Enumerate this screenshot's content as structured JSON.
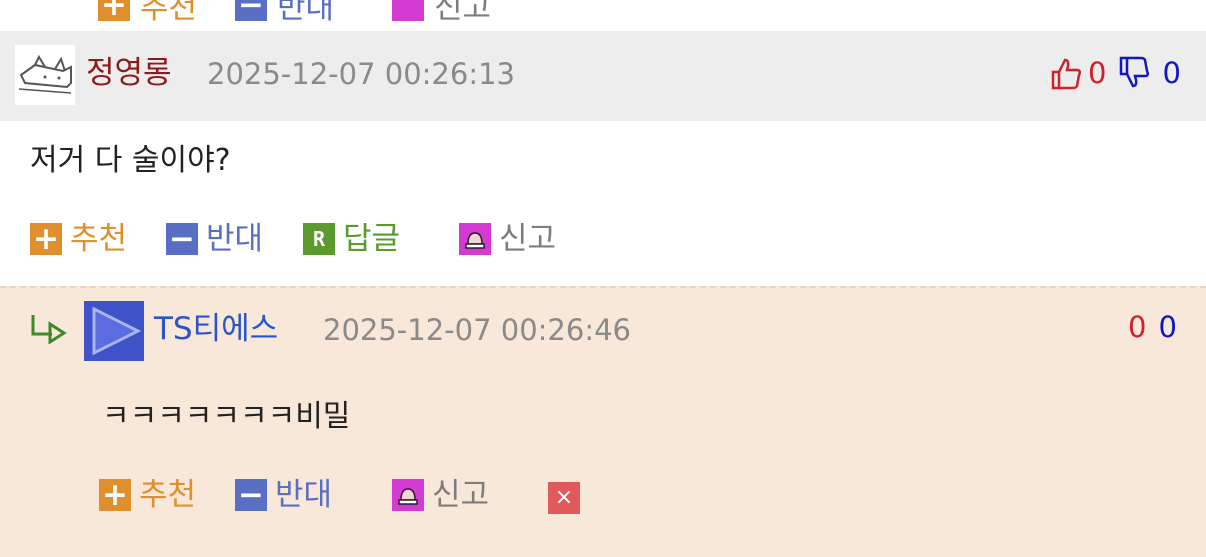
{
  "top_row": {
    "up_label": "추천",
    "down_label": "반대",
    "report_label": "신고"
  },
  "comment": {
    "author": "정영롱",
    "timestamp": "2025-12-07 00:26:13",
    "likes": "0",
    "dislikes": "0",
    "text": "저거 다 술이야?",
    "actions": {
      "recommend": "추천",
      "oppose": "반대",
      "reply": "답글",
      "report": "신고"
    }
  },
  "reply": {
    "author": "TS티에스",
    "timestamp": "2025-12-07 00:26:46",
    "likes": "0",
    "dislikes": "0",
    "text": "ㅋㅋㅋㅋㅋㅋㅋ비밀",
    "actions": {
      "recommend": "추천",
      "oppose": "반대",
      "report": "신고"
    }
  },
  "colors": {
    "header_bg": "#ededed",
    "reply_bg": "#f7e8d9",
    "author_red": "#8b1a1a",
    "author_blue": "#2a55c8",
    "up_red": "#d0202a",
    "down_blue": "#1414c8",
    "orange": "#e08f2e",
    "slate": "#5a6fc4",
    "green": "#5a9a2e",
    "magenta": "#d33bd3"
  }
}
